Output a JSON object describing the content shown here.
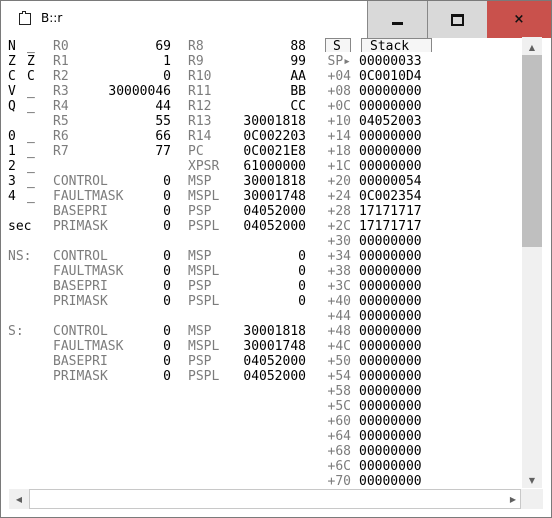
{
  "window": {
    "title": "B::r",
    "buttons": {
      "minimize": "minimize-icon",
      "maximize": "maximize-icon",
      "close": "×"
    }
  },
  "flags": [
    {
      "name": "N",
      "value": "_"
    },
    {
      "name": "Z",
      "value": "Z"
    },
    {
      "name": "C",
      "value": "C"
    },
    {
      "name": "V",
      "value": "_"
    },
    {
      "name": "Q",
      "value": "_"
    },
    {
      "name": "0",
      "value": "_"
    },
    {
      "name": "1",
      "value": "_"
    },
    {
      "name": "2",
      "value": "_"
    },
    {
      "name": "3",
      "value": "_"
    },
    {
      "name": "4",
      "value": "_"
    }
  ],
  "sec_label": "sec",
  "registers_low": [
    {
      "name": "R0",
      "value": "69"
    },
    {
      "name": "R1",
      "value": "1"
    },
    {
      "name": "R2",
      "value": "0"
    },
    {
      "name": "R3",
      "value": "30000046"
    },
    {
      "name": "R4",
      "value": "44"
    },
    {
      "name": "R5",
      "value": "55"
    },
    {
      "name": "R6",
      "value": "66"
    },
    {
      "name": "R7",
      "value": "77"
    }
  ],
  "registers_high": [
    {
      "name": "R8",
      "value": "88"
    },
    {
      "name": "R9",
      "value": "99"
    },
    {
      "name": "R10",
      "value": "AA"
    },
    {
      "name": "R11",
      "value": "BB"
    },
    {
      "name": "R12",
      "value": "CC"
    },
    {
      "name": "R13",
      "value": "30001818"
    },
    {
      "name": "R14",
      "value": "0C002203"
    },
    {
      "name": "PC",
      "value": "0C0021E8"
    },
    {
      "name": "XPSR",
      "value": "61000000"
    },
    {
      "name": "MSP",
      "value": "30001818"
    },
    {
      "name": "MSPL",
      "value": "30001748"
    },
    {
      "name": "PSP",
      "value": "04052000"
    },
    {
      "name": "PSPL",
      "value": "04052000"
    }
  ],
  "special_regs": [
    {
      "name": "CONTROL",
      "value": "0"
    },
    {
      "name": "FAULTMASK",
      "value": "0"
    },
    {
      "name": "BASEPRI",
      "value": "0"
    },
    {
      "name": "PRIMASK",
      "value": "0"
    }
  ],
  "ns": {
    "label": "NS:",
    "special": [
      {
        "name": "CONTROL",
        "value": "0"
      },
      {
        "name": "FAULTMASK",
        "value": "0"
      },
      {
        "name": "BASEPRI",
        "value": "0"
      },
      {
        "name": "PRIMASK",
        "value": "0"
      }
    ],
    "stack": [
      {
        "name": "MSP",
        "value": "0"
      },
      {
        "name": "MSPL",
        "value": "0"
      },
      {
        "name": "PSP",
        "value": "0"
      },
      {
        "name": "PSPL",
        "value": "0"
      }
    ]
  },
  "s": {
    "label": "S:",
    "special": [
      {
        "name": "CONTROL",
        "value": "0"
      },
      {
        "name": "FAULTMASK",
        "value": "0"
      },
      {
        "name": "BASEPRI",
        "value": "0"
      },
      {
        "name": "PRIMASK",
        "value": "0"
      }
    ],
    "stack": [
      {
        "name": "MSP",
        "value": "30001818"
      },
      {
        "name": "MSPL",
        "value": "30001748"
      },
      {
        "name": "PSP",
        "value": "04052000"
      },
      {
        "name": "PSPL",
        "value": "04052000"
      }
    ]
  },
  "stack_header": {
    "s": "S",
    "stack": "Stack"
  },
  "stack": [
    {
      "offset": "SP▸",
      "value": "00000033"
    },
    {
      "offset": "+04",
      "value": "0C0010D4"
    },
    {
      "offset": "+08",
      "value": "00000000"
    },
    {
      "offset": "+0C",
      "value": "00000000"
    },
    {
      "offset": "+10",
      "value": "04052003"
    },
    {
      "offset": "+14",
      "value": "00000000"
    },
    {
      "offset": "+18",
      "value": "00000000"
    },
    {
      "offset": "+1C",
      "value": "00000000"
    },
    {
      "offset": "+20",
      "value": "00000054"
    },
    {
      "offset": "+24",
      "value": "0C002354"
    },
    {
      "offset": "+28",
      "value": "17171717"
    },
    {
      "offset": "+2C",
      "value": "17171717"
    },
    {
      "offset": "+30",
      "value": "00000000"
    },
    {
      "offset": "+34",
      "value": "00000000"
    },
    {
      "offset": "+38",
      "value": "00000000"
    },
    {
      "offset": "+3C",
      "value": "00000000"
    },
    {
      "offset": "+40",
      "value": "00000000"
    },
    {
      "offset": "+44",
      "value": "00000000"
    },
    {
      "offset": "+48",
      "value": "00000000"
    },
    {
      "offset": "+4C",
      "value": "00000000"
    },
    {
      "offset": "+50",
      "value": "00000000"
    },
    {
      "offset": "+54",
      "value": "00000000"
    },
    {
      "offset": "+58",
      "value": "00000000"
    },
    {
      "offset": "+5C",
      "value": "00000000"
    },
    {
      "offset": "+60",
      "value": "00000000"
    },
    {
      "offset": "+64",
      "value": "00000000"
    },
    {
      "offset": "+68",
      "value": "00000000"
    },
    {
      "offset": "+6C",
      "value": "00000000"
    },
    {
      "offset": "+70",
      "value": "00000000"
    }
  ],
  "scroll": {
    "up": "▲",
    "down": "▼",
    "left": "◀",
    "right": "▶"
  }
}
